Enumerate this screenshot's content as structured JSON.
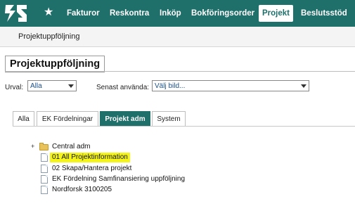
{
  "nav": {
    "items": [
      {
        "label": "Fakturor"
      },
      {
        "label": "Reskontra"
      },
      {
        "label": "Inköp"
      },
      {
        "label": "Bokföringsorder"
      },
      {
        "label": "Projekt",
        "active": true
      },
      {
        "label": "Beslutsstöd"
      }
    ],
    "star_icon": "star-icon",
    "logo_icon": "app-logo-icon",
    "brand_color": "#1f6f6a"
  },
  "subnav": {
    "label": "Projektuppföljning"
  },
  "page": {
    "title": "Projektuppföljning"
  },
  "filters": {
    "urval_label": "Urval:",
    "urval_value": "Alla",
    "senast_label": "Senast använda:",
    "senast_value": "Välj bild..."
  },
  "tabs": [
    {
      "label": "Alla"
    },
    {
      "label": "EK Fördelningar"
    },
    {
      "label": "Projekt adm",
      "active": true
    },
    {
      "label": "System"
    }
  ],
  "tree": {
    "items": [
      {
        "label": "Central adm",
        "type": "folder",
        "expander": "+"
      },
      {
        "label": "01 All Projektinformation",
        "type": "document",
        "highlighted": true,
        "highlight_color": "#f4f41a"
      },
      {
        "label": "02 Skapa/Hantera projekt",
        "type": "document"
      },
      {
        "label": "EK Fördelning Samfinansiering uppföljning",
        "type": "document"
      },
      {
        "label": "Nordforsk 3100205",
        "type": "document"
      }
    ]
  }
}
